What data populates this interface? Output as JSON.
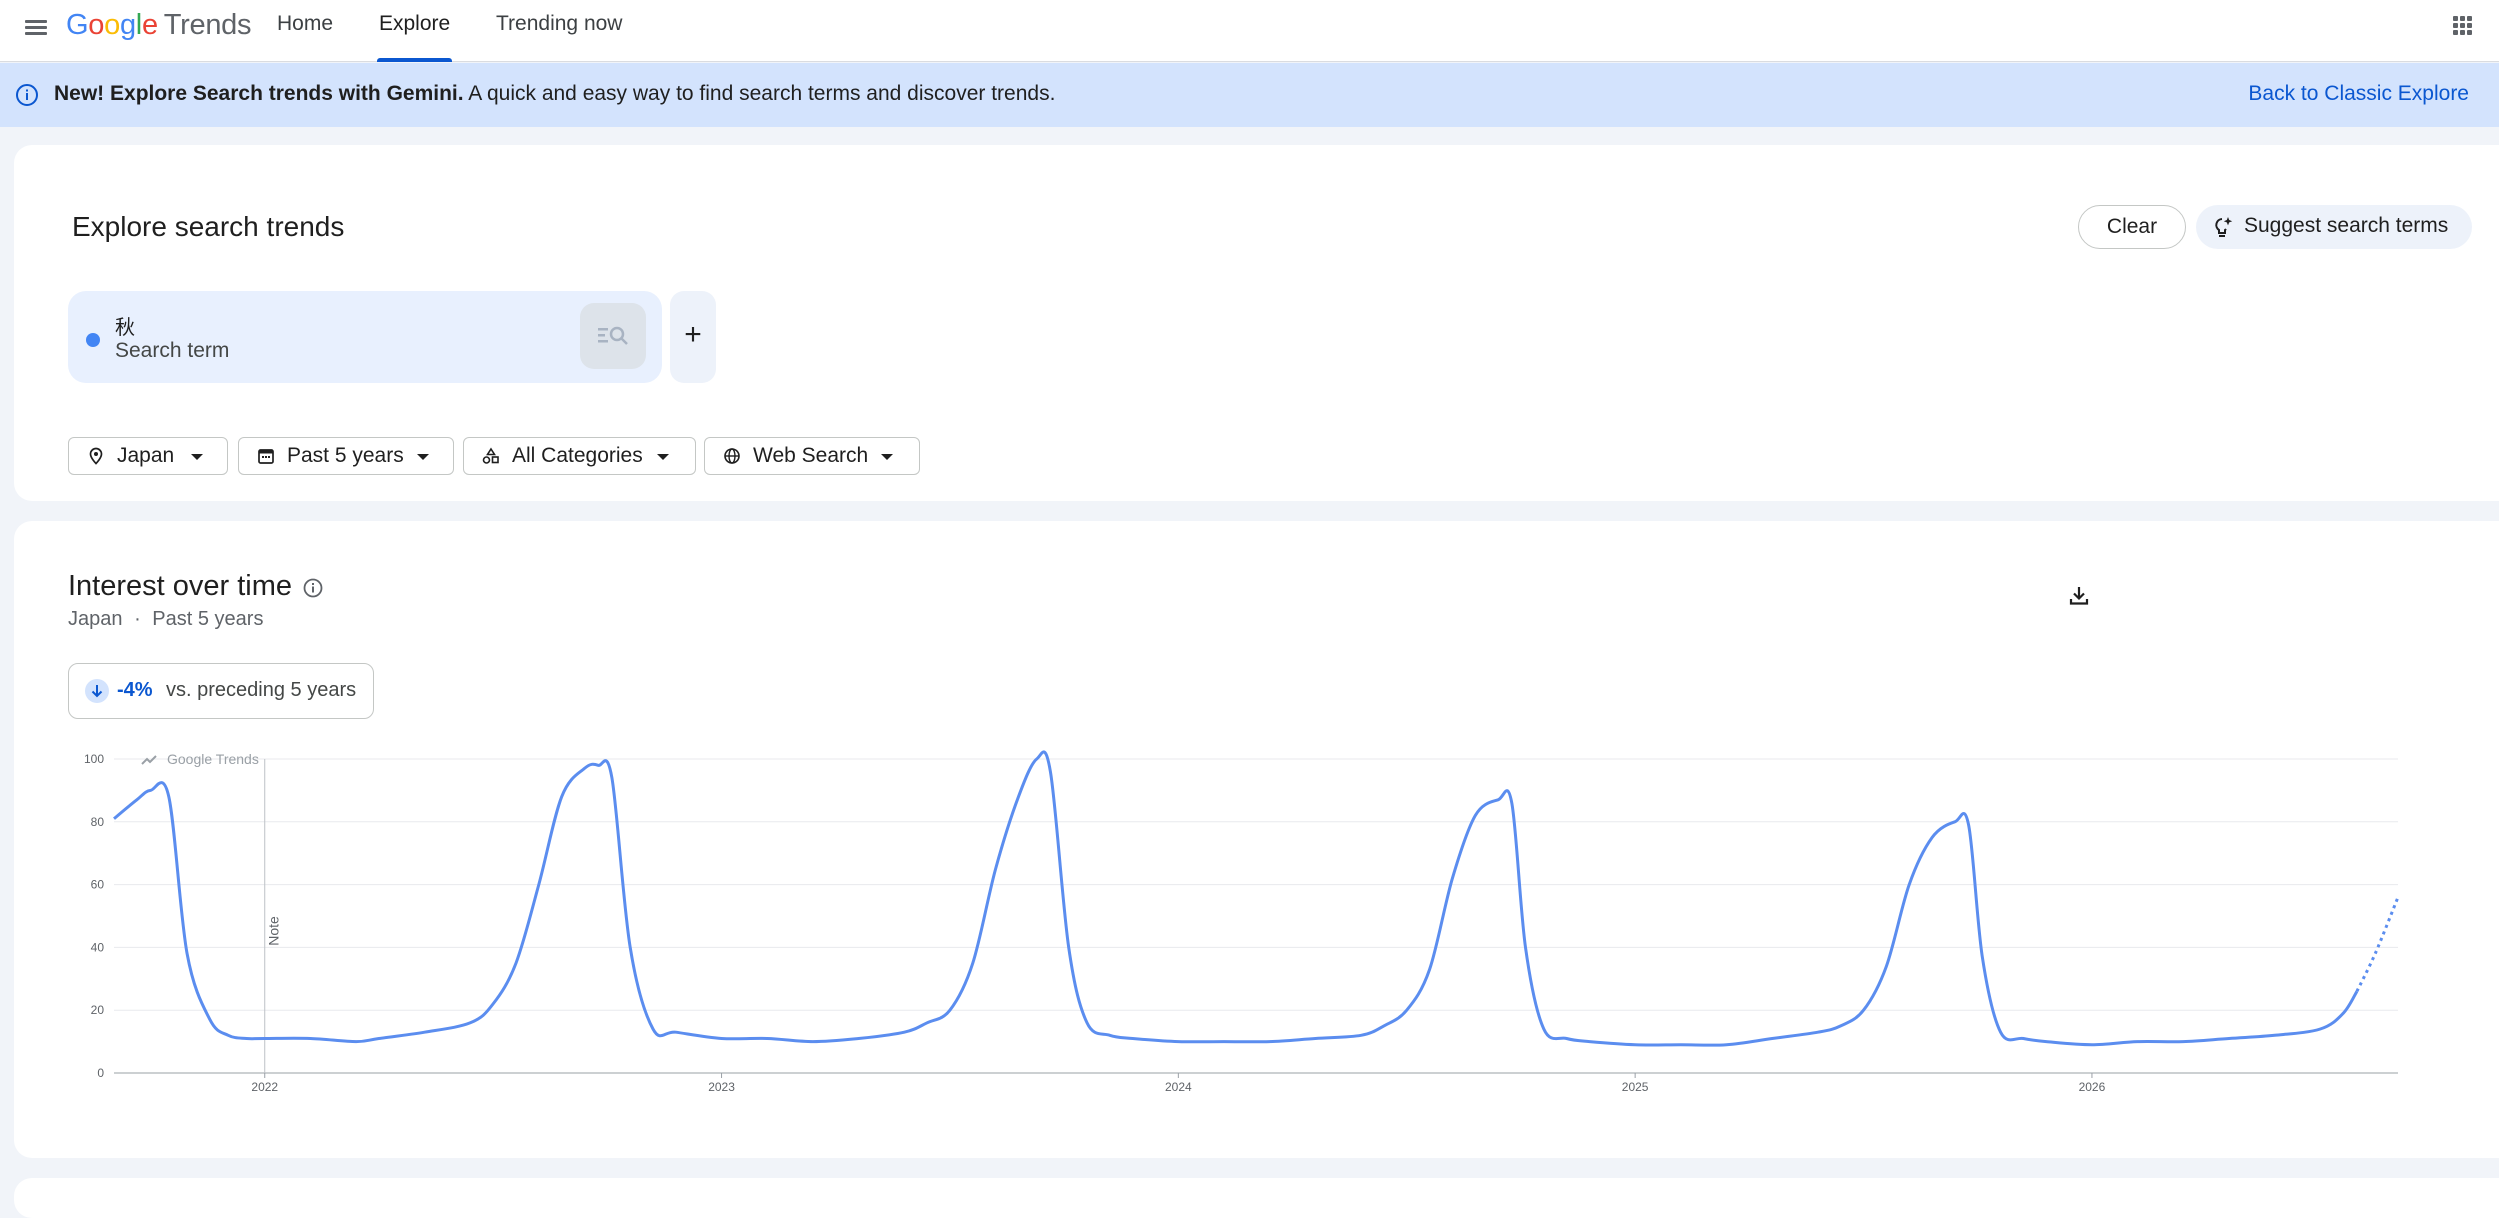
{
  "header": {
    "logo_google": "Google",
    "logo_trends": "Trends",
    "tabs": [
      {
        "label": "Home"
      },
      {
        "label": "Explore",
        "active": true
      },
      {
        "label": "Trending now"
      }
    ],
    "icons": {
      "menu": "menu-icon",
      "apps": "apps-grid-icon"
    }
  },
  "banner": {
    "bold": "New! Explore Search trends with Gemini.",
    "text": " A quick and easy way to find search terms and discover trends.",
    "link": "Back to Classic Explore",
    "icon": "info-icon"
  },
  "explore": {
    "title": "Explore search trends",
    "clear_label": "Clear",
    "suggest_label": "Suggest search terms",
    "term": {
      "value": "秋",
      "type_label": "Search term",
      "color": "#4285f4"
    },
    "add_label": "+",
    "filters": [
      {
        "label": "Japan",
        "icon": "location-pin-icon"
      },
      {
        "label": "Past 5 years",
        "icon": "calendar-icon"
      },
      {
        "label": "All Categories",
        "icon": "categories-icon"
      },
      {
        "label": "Web Search",
        "icon": "globe-icon"
      }
    ]
  },
  "interest": {
    "title": "Interest over time",
    "location": "Japan",
    "separator": "·",
    "period": "Past 5 years",
    "change_pct": "-4%",
    "change_text": "vs. preceding 5 years",
    "watermark": "Google Trends",
    "note_label": "Note"
  },
  "chart_data": {
    "type": "line",
    "title": "",
    "xlabel": "",
    "ylabel": "",
    "ylim": [
      0,
      100
    ],
    "yticks": [
      0,
      20,
      40,
      60,
      80,
      100
    ],
    "xticks": [
      2022,
      2023,
      2024,
      2025,
      2026
    ],
    "grid": true,
    "x_range": [
      2021.67,
      2026.67
    ],
    "partial_from": 2026.58,
    "series": [
      {
        "color": "#5b8def",
        "x": [
          2021.67,
          2021.72,
          2021.75,
          2021.79,
          2021.83,
          2021.88,
          2021.92,
          2021.96,
          2022.0,
          2022.1,
          2022.2,
          2022.25,
          2022.35,
          2022.45,
          2022.5,
          2022.55,
          2022.6,
          2022.65,
          2022.7,
          2022.73,
          2022.76,
          2022.8,
          2022.85,
          2022.9,
          2023.0,
          2023.1,
          2023.2,
          2023.3,
          2023.4,
          2023.45,
          2023.5,
          2023.55,
          2023.6,
          2023.65,
          2023.69,
          2023.72,
          2023.76,
          2023.8,
          2023.85,
          2023.9,
          2024.0,
          2024.1,
          2024.2,
          2024.3,
          2024.4,
          2024.45,
          2024.5,
          2024.55,
          2024.6,
          2024.65,
          2024.7,
          2024.73,
          2024.76,
          2024.8,
          2024.85,
          2024.9,
          2025.0,
          2025.1,
          2025.2,
          2025.3,
          2025.4,
          2025.45,
          2025.5,
          2025.55,
          2025.6,
          2025.65,
          2025.7,
          2025.73,
          2025.76,
          2025.8,
          2025.85,
          2025.9,
          2026.0,
          2026.1,
          2026.2,
          2026.3,
          2026.4,
          2026.5,
          2026.55,
          2026.58,
          2026.62,
          2026.67
        ],
        "y": [
          81,
          87,
          90,
          88,
          38,
          17,
          12,
          11,
          11,
          11,
          10,
          11,
          13,
          16,
          22,
          35,
          60,
          88,
          97,
          98,
          94,
          40,
          14,
          13,
          11,
          11,
          10,
          11,
          13,
          16,
          20,
          35,
          65,
          88,
          100,
          96,
          40,
          16,
          12,
          11,
          10,
          10,
          10,
          11,
          12,
          15,
          20,
          33,
          62,
          82,
          87,
          86,
          40,
          14,
          11,
          10,
          9,
          9,
          9,
          11,
          13,
          15,
          20,
          34,
          60,
          75,
          80,
          79,
          37,
          13,
          11,
          10,
          9,
          10,
          10,
          11,
          12,
          14,
          19,
          26,
          38,
          56
        ]
      }
    ]
  }
}
